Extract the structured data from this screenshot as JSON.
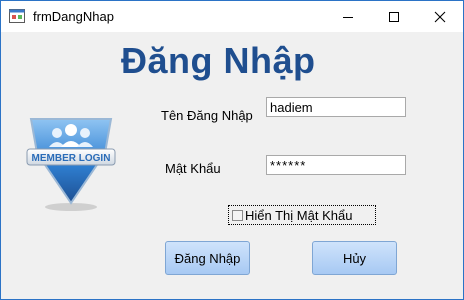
{
  "window": {
    "title": "frmDangNhap",
    "controls": {
      "minimize_icon": "minimize-icon",
      "maximize_icon": "maximize-icon",
      "close_icon": "close-icon"
    }
  },
  "form": {
    "heading": "Đăng Nhập",
    "username_label": "Tên Đăng Nhập",
    "username_value": "hadiem",
    "password_label": "Mật Khẩu",
    "password_value": "******",
    "show_password_label": "Hiển Thị Mật Khẩu",
    "show_password_checked": false,
    "login_button": "Đăng Nhập",
    "cancel_button": "Hủy"
  },
  "logo": {
    "text": "MEMBER LOGIN",
    "icon": "member-login-badge"
  },
  "colors": {
    "heading": "#1f4e8f",
    "window_border": "#2b73c6",
    "button_top": "#cfe3fb",
    "button_bottom": "#a7c9f3",
    "badge_blue": "#2f7fd1"
  }
}
